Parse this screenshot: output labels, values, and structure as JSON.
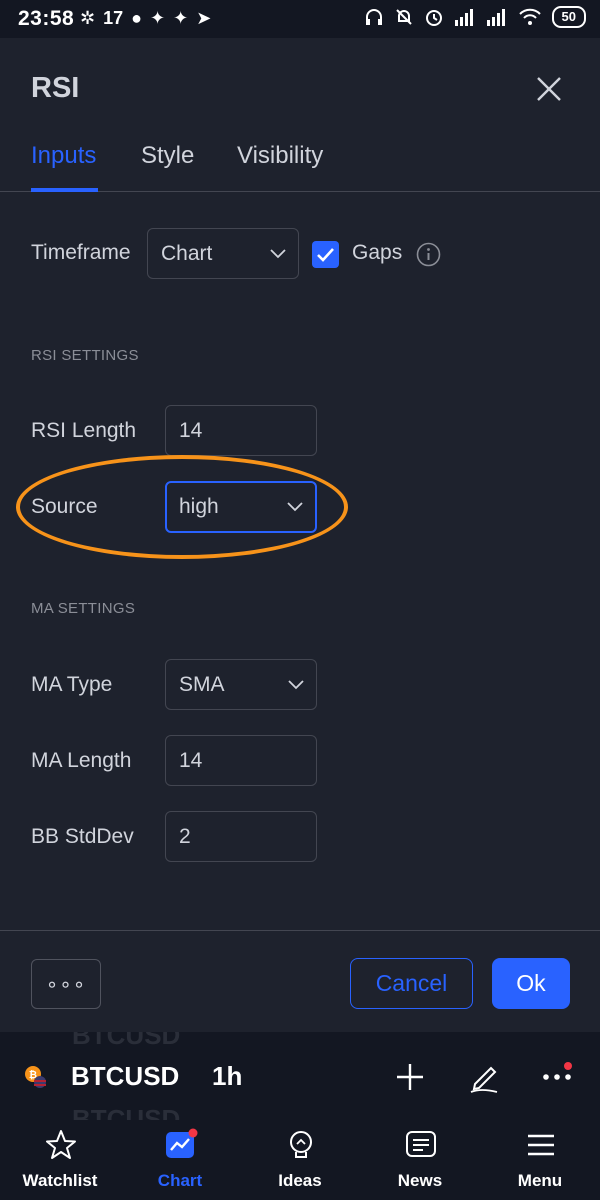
{
  "status_bar": {
    "time": "23:58",
    "battery": "50"
  },
  "dialog": {
    "title": "RSI",
    "tabs": [
      {
        "label": "Inputs",
        "active": true
      },
      {
        "label": "Style",
        "active": false
      },
      {
        "label": "Visibility",
        "active": false
      }
    ],
    "timeframe": {
      "label": "Timeframe",
      "value": "Chart"
    },
    "gaps": {
      "label": "Gaps",
      "checked": true
    },
    "rsi_section": "RSI SETTINGS",
    "rsi_length": {
      "label": "RSI Length",
      "value": "14"
    },
    "source": {
      "label": "Source",
      "value": "high"
    },
    "ma_section": "MA SETTINGS",
    "ma_type": {
      "label": "MA Type",
      "value": "SMA"
    },
    "ma_length": {
      "label": "MA Length",
      "value": "14"
    },
    "bb_stddev": {
      "label": "BB StdDev",
      "value": "2"
    },
    "footer": {
      "more": "∘∘∘",
      "cancel": "Cancel",
      "ok": "Ok"
    }
  },
  "chart_bar": {
    "symbol": "BTCUSD",
    "interval": "1h",
    "ghost_text": "BTCUSD"
  },
  "bottom_nav": [
    {
      "label": "Watchlist",
      "icon": "star-icon",
      "active": false
    },
    {
      "label": "Chart",
      "icon": "chart-icon",
      "active": true
    },
    {
      "label": "Ideas",
      "icon": "lightbulb-icon",
      "active": false
    },
    {
      "label": "News",
      "icon": "news-icon",
      "active": false
    },
    {
      "label": "Menu",
      "icon": "hamburger-icon",
      "active": false
    }
  ],
  "colors": {
    "accent": "#2962ff",
    "highlight": "#f7931a",
    "background": "#1e222d",
    "notification": "#f23645"
  }
}
